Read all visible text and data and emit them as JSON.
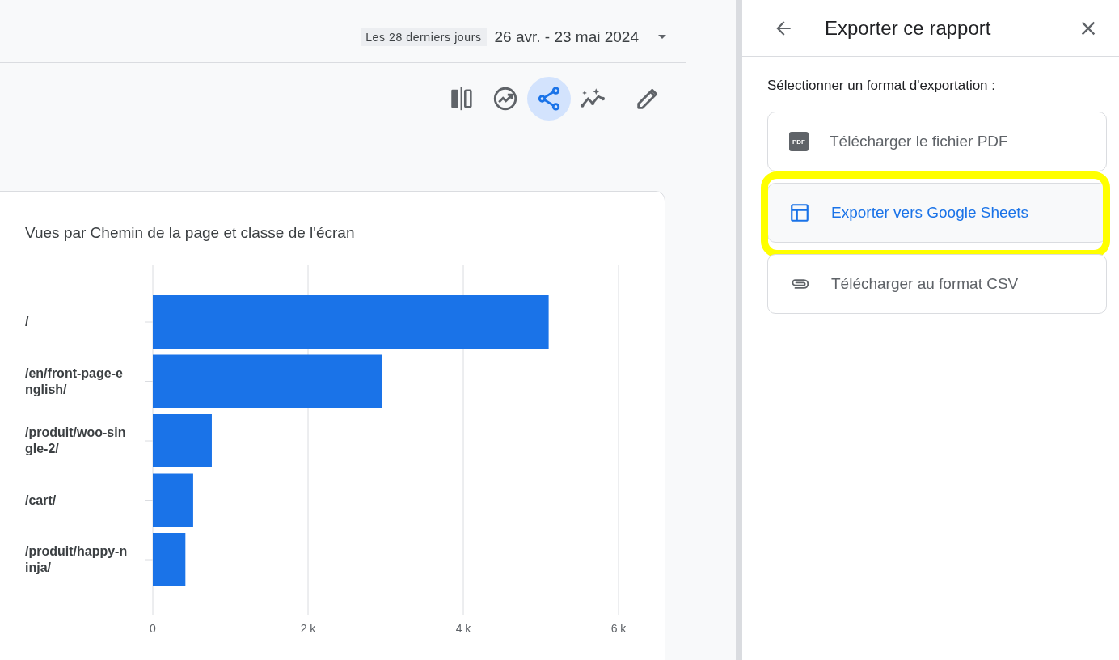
{
  "date_range": {
    "preset": "Les 28 derniers jours",
    "range": "26 avr. - 23 mai 2024"
  },
  "toolbar": [
    {
      "selected": false
    },
    {
      "selected": false
    },
    {
      "selected": true
    },
    {
      "selected": false
    },
    {
      "selected": false
    }
  ],
  "card": {
    "title": "Vues par Chemin de la page et classe de l'écran",
    "chart_data": {
      "type": "bar",
      "orientation": "horizontal",
      "categories": [
        "/",
        "/en/front-page-english/",
        "/produit/woo-single-2/",
        "/cart/",
        "/produit/happy-ninja/"
      ],
      "series": [
        {
          "color": "#1a73e8",
          "values": [
            5100,
            2950,
            760,
            520,
            420
          ]
        }
      ],
      "xlim": [
        0,
        6000
      ],
      "xticks": [
        {
          "value": 0,
          "label": "0"
        },
        {
          "value": 2000,
          "label": "2 k"
        },
        {
          "value": 4000,
          "label": "4 k"
        },
        {
          "value": 6000,
          "label": "6 k"
        }
      ]
    }
  },
  "panel": {
    "title": "Exporter ce rapport",
    "subtitle": "Sélectionner un format d'exportation :",
    "options": [
      {
        "label": "Télécharger le fichier PDF",
        "icon_text": "PDF",
        "selected": false,
        "highlighted": false
      },
      {
        "label": "Exporter vers Google Sheets",
        "selected": true,
        "highlighted": true
      },
      {
        "label": "Télécharger au format CSV",
        "selected": false,
        "highlighted": false
      }
    ]
  }
}
